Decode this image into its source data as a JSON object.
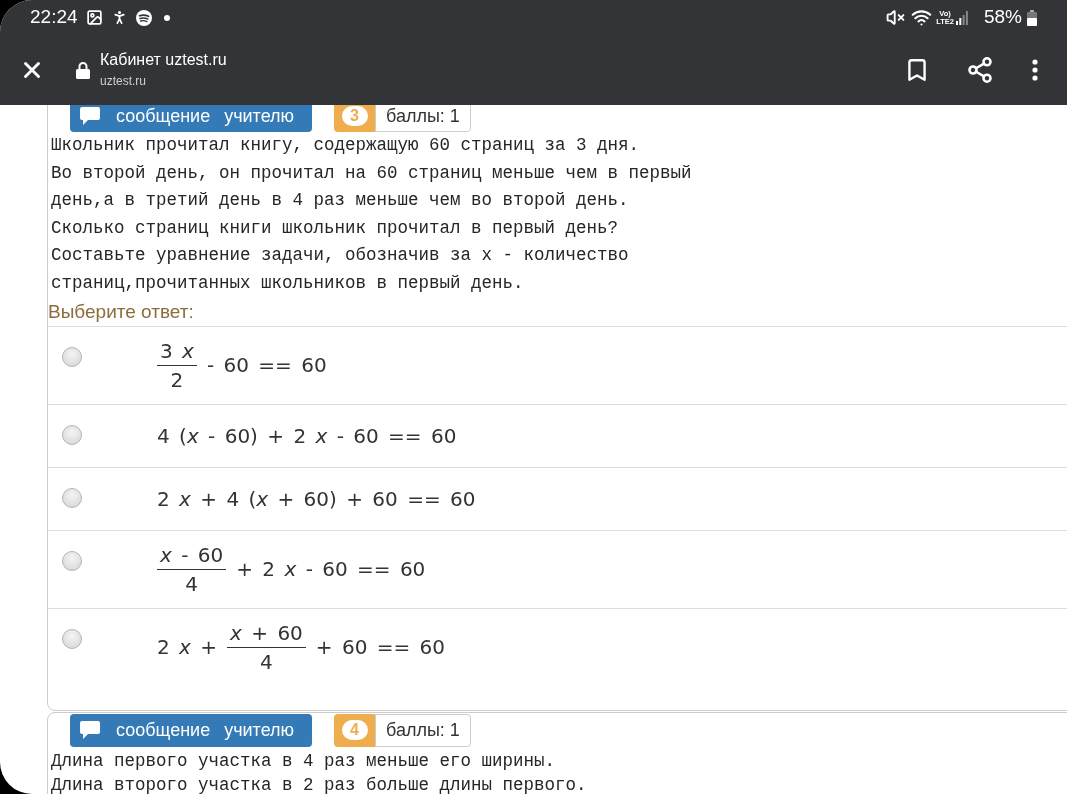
{
  "status_bar": {
    "time": "22:24",
    "network": "Vo)\nLTE2",
    "battery": "58%"
  },
  "toolbar": {
    "title": "Кабинет uztest.ru",
    "url": "uztest.ru"
  },
  "questions": [
    {
      "message_button": "сообщение учителю",
      "number": "3",
      "points": "баллы: 1",
      "text": "Школьник прочитал книгу, содержащую 60 страниц за 3 дня.\nВо второй день, он прочитал на 60 страниц меньше чем в первый\nдень,а в третий день в 4 раз меньше чем во второй день.\nСколько страниц книги школьник прочитал в первый день?\nСоставьте уравнение задачи, обозначив за x - количество\nстраниц,прочитанных школьников в первый день.",
      "prompt": "Выберите ответ:",
      "answers": [
        {
          "selected": false,
          "parts": [
            {
              "kind": "frac",
              "num": "3 *x*",
              "den": "2"
            },
            {
              "kind": "text",
              "text": "- 60 == 60"
            }
          ]
        },
        {
          "selected": false,
          "parts": [
            {
              "kind": "text",
              "text": "4 (*x* - 60) + 2 *x* - 60 == 60"
            }
          ]
        },
        {
          "selected": false,
          "parts": [
            {
              "kind": "text",
              "text": "2 *x* + 4 (*x* + 60) + 60 == 60"
            }
          ]
        },
        {
          "selected": false,
          "parts": [
            {
              "kind": "frac",
              "num": "*x* - 60",
              "den": "4"
            },
            {
              "kind": "text",
              "text": "+ 2 *x* - 60 == 60"
            }
          ]
        },
        {
          "selected": false,
          "parts": [
            {
              "kind": "text",
              "text": "2 *x* +"
            },
            {
              "kind": "frac",
              "num": "*x* + 60",
              "den": "4"
            },
            {
              "kind": "text",
              "text": "+ 60 == 60"
            }
          ]
        }
      ]
    },
    {
      "message_button": "сообщение учителю",
      "number": "4",
      "points": "баллы: 1",
      "text": "Длина первого участка в 4 раз меньше его ширины.\nДлина второго участка в 2 раз больше длины первого."
    }
  ]
}
